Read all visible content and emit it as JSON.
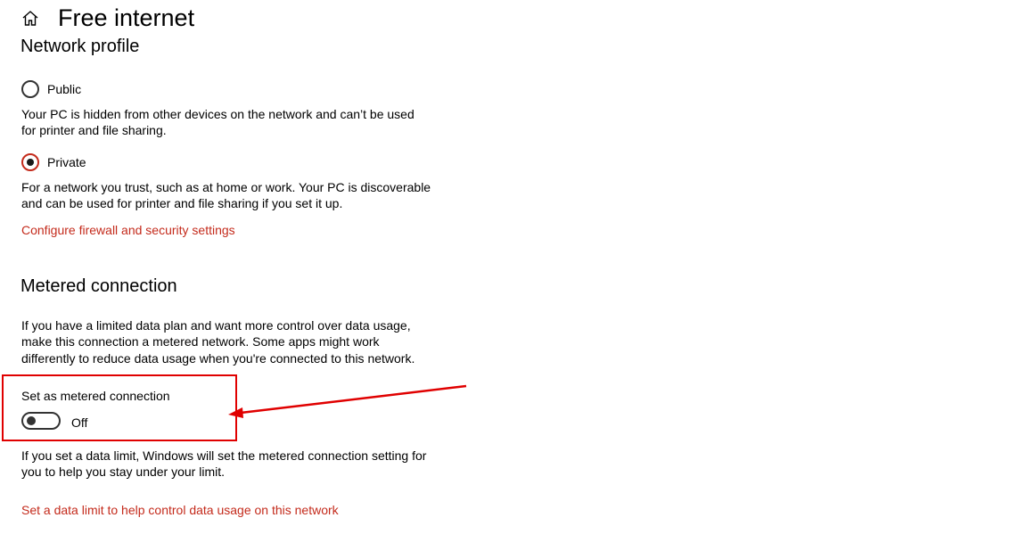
{
  "header": {
    "title": "Free internet",
    "home_icon": "home-icon"
  },
  "network_profile": {
    "heading": "Network profile",
    "options": [
      {
        "label": "Public",
        "checked": false,
        "description": "Your PC is hidden from other devices on the network and can’t be used for printer and file sharing."
      },
      {
        "label": "Private",
        "checked": true,
        "description": "For a network you trust, such as at home or work. Your PC is discoverable and can be used for printer and file sharing if you set it up."
      }
    ],
    "firewall_link": "Configure firewall and security settings"
  },
  "metered": {
    "heading": "Metered connection",
    "description": "If you have a limited data plan and want more control over data usage, make this connection a metered network. Some apps might work differently to reduce data usage when you're connected to this network.",
    "toggle_label": "Set as metered connection",
    "toggle_state": "Off",
    "toggle_on": false,
    "data_limit_note": "If you set a data limit, Windows will set the metered connection setting for you to help you stay under your limit.",
    "data_limit_link": "Set a data limit to help control data usage on this network"
  },
  "colors": {
    "accent": "#c42b1c",
    "annotation": "#e00000",
    "text": "#000000"
  }
}
